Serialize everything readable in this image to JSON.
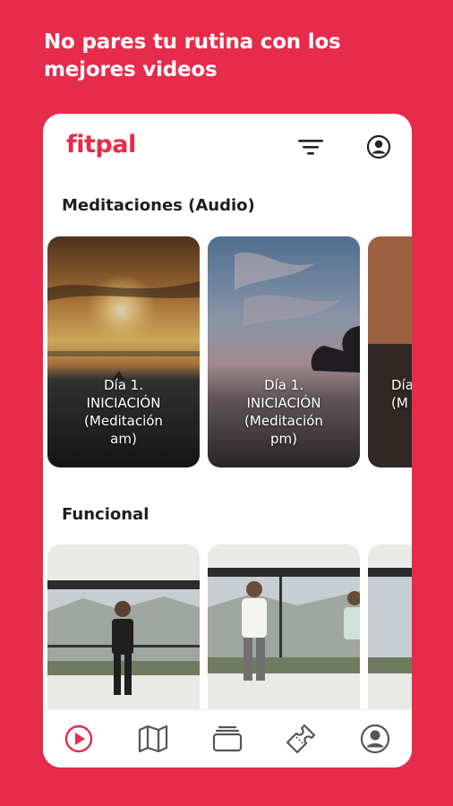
{
  "headline": "No pares tu rutina con los mejores videos",
  "app": {
    "logo": "fitpal"
  },
  "sections": [
    {
      "title": "Meditaciones (Audio)",
      "cards": [
        {
          "caption": "Día 1.\nINICIACIÓN\n(Meditación\nam)"
        },
        {
          "caption": "Día 1.\nINICIACIÓN\n(Meditación\npm)"
        },
        {
          "caption": "Día\n(M"
        }
      ]
    },
    {
      "title": "Funcional",
      "cards": [
        {
          "caption": ""
        },
        {
          "caption": ""
        },
        {
          "caption": ""
        }
      ]
    }
  ],
  "bottom_nav": [
    "play-icon",
    "map-icon",
    "cards-icon",
    "ticket-icon",
    "profile-icon"
  ],
  "colors": {
    "brand": "#e72b4b",
    "text": "#1e1e1e",
    "nav_icon": "#555555"
  }
}
